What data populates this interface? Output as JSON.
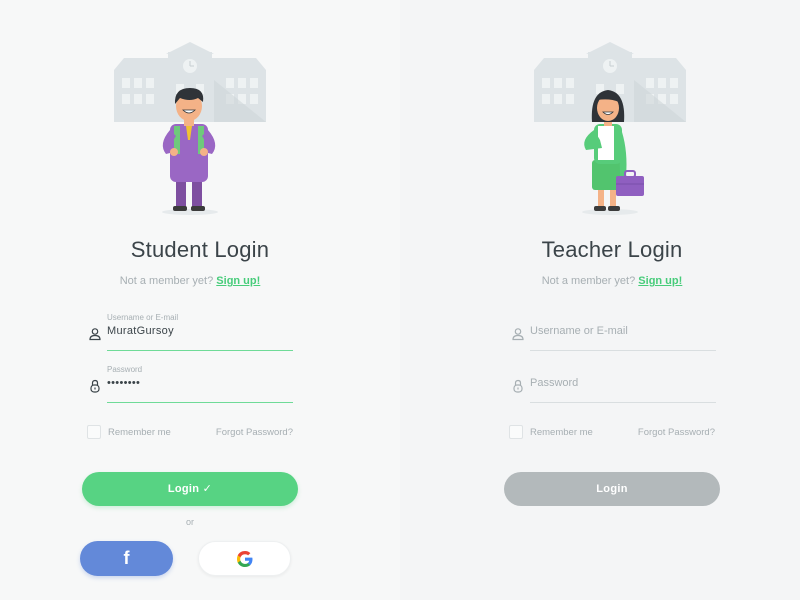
{
  "student": {
    "title": "Student Login",
    "member_prefix": "Not a member yet?",
    "signup_link": "Sign up!",
    "username": {
      "label": "Username or E-mail",
      "value": "MuratGursoy"
    },
    "password": {
      "label": "Password",
      "value": "••••••••"
    },
    "remember_label": "Remember me",
    "forgot_label": "Forgot Password?",
    "login_label": "Login ✓",
    "or_label": "or",
    "facebook_glyph": "f",
    "google_glyph": "G"
  },
  "teacher": {
    "title": "Teacher Login",
    "member_prefix": "Not a member yet?",
    "signup_link": "Sign up!",
    "username_placeholder": "Username or E-mail",
    "password_placeholder": "Password",
    "remember_label": "Remember me",
    "forgot_label": "Forgot Password?",
    "login_label": "Login"
  },
  "colors": {
    "accent_green": "#57d383",
    "link_green": "#47cc7a",
    "facebook_blue": "#6389d9",
    "disabled_gray": "#b3b9bb",
    "text_dark": "#3b4449",
    "text_muted": "#a7afb3"
  },
  "icons": {
    "username": "user-icon",
    "password": "lock-icon",
    "facebook": "facebook-icon",
    "google": "google-icon"
  }
}
